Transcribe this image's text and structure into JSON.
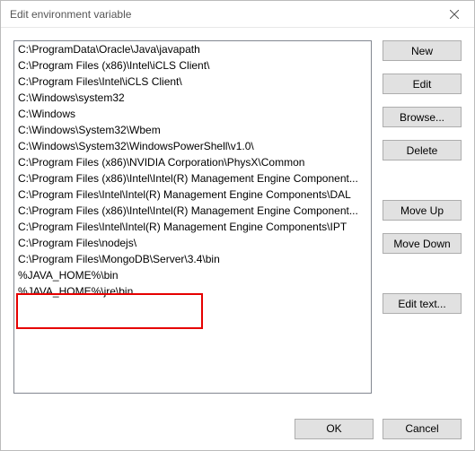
{
  "window": {
    "title": "Edit environment variable"
  },
  "list": {
    "items": [
      "C:\\ProgramData\\Oracle\\Java\\javapath",
      "C:\\Program Files (x86)\\Intel\\iCLS Client\\",
      "C:\\Program Files\\Intel\\iCLS Client\\",
      "C:\\Windows\\system32",
      "C:\\Windows",
      "C:\\Windows\\System32\\Wbem",
      "C:\\Windows\\System32\\WindowsPowerShell\\v1.0\\",
      "C:\\Program Files (x86)\\NVIDIA Corporation\\PhysX\\Common",
      "C:\\Program Files (x86)\\Intel\\Intel(R) Management Engine Component...",
      "C:\\Program Files\\Intel\\Intel(R) Management Engine Components\\DAL",
      "C:\\Program Files (x86)\\Intel\\Intel(R) Management Engine Component...",
      "C:\\Program Files\\Intel\\Intel(R) Management Engine Components\\IPT",
      "C:\\Program Files\\nodejs\\",
      "C:\\Program Files\\MongoDB\\Server\\3.4\\bin",
      "%JAVA_HOME%\\bin",
      "%JAVA_HOME%\\jre\\bin"
    ]
  },
  "buttons": {
    "new": "New",
    "edit": "Edit",
    "browse": "Browse...",
    "delete": "Delete",
    "move_up": "Move Up",
    "move_down": "Move Down",
    "edit_text": "Edit text...",
    "ok": "OK",
    "cancel": "Cancel"
  }
}
